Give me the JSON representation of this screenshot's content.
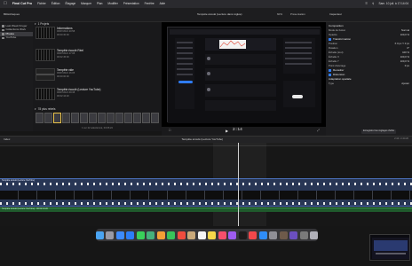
{
  "menubar": {
    "app_name": "Final Cut Pro",
    "items": [
      "Fichier",
      "Édition",
      "Élagage",
      "Marquer",
      "Plan",
      "Modifier",
      "Présentation",
      "Fenêtre",
      "Aide"
    ],
    "clock": "Sam. 10 juil. à 17:14:04"
  },
  "library_header": {
    "title": "Bibliothèques"
  },
  "viewer_header": {
    "title": "Tempête écoulé (Lecture dans réglée)",
    "zoom": "60%",
    "mode": "Présentation"
  },
  "inspector_header": {
    "title": "Inspecteur"
  },
  "sidebar": {
    "items": [
      {
        "label": "Last Week Kruger"
      },
      {
        "label": "Collections Work"
      },
      {
        "label": "Photos"
      },
      {
        "label": "YouTube"
      }
    ]
  },
  "browser": {
    "group_label": "1 Projets",
    "clips": [
      {
        "title": "Informations",
        "sub1": "06/07/2021 20:58",
        "sub2": "00:00:30:00"
      },
      {
        "title": "Tempête écoulé Réel",
        "sub1": "06/07/2021 17:08",
        "sub2": "00:02:45:00"
      },
      {
        "title": "Tempête vide",
        "sub1": "06/07/2021 16:05",
        "sub2": "00:00:00:00"
      },
      {
        "title": "Tempête écoulé (Lecture YouTube)",
        "sub1": "06/07/2021 09:38",
        "sub2": "00:02:44:20"
      }
    ],
    "filmstrip_group": "78 plus rebels",
    "footer": "1 sur 22 sélectionné, 03:06:24"
  },
  "viewer": {
    "timecode": "2:14"
  },
  "inspector": {
    "rows": [
      {
        "label": "Composition",
        "value": ""
      },
      {
        "label": "Mode de fusion",
        "value": "Normal"
      },
      {
        "label": "Opacité",
        "value": "100,0 %"
      },
      {
        "label": "Transformation",
        "value": ""
      },
      {
        "label": "Position",
        "value": "X 0 px  Y 0 px"
      },
      {
        "label": "Rotation",
        "value": "0°"
      },
      {
        "label": "Échelle (tout)",
        "value": "100 %"
      },
      {
        "label": "Échelle X",
        "value": "100,0 %"
      },
      {
        "label": "Échelle Y",
        "value": "100,0 %"
      },
      {
        "label": "Point d'ancrage",
        "value": "0 px"
      },
      {
        "label": "Recadrer",
        "value": ""
      },
      {
        "label": "Distorsion",
        "value": ""
      },
      {
        "label": "Adaptation spatiale",
        "value": ""
      },
      {
        "label": "Type",
        "value": "Ajuster"
      }
    ],
    "footer_button": "Enregistrer les réglages d'effet"
  },
  "timeline": {
    "index_label": "Index",
    "project": "Tempête écoulé (Lecture YouTube)",
    "duration": "2:44 / 2:44:20",
    "clip_label": "Tempête écoulé (Lecture YouTube)",
    "audio_label": "Tempête écoulé (Lecture YouTube) - 00:02:44:20"
  },
  "dock": {
    "icons": [
      "finder-icon",
      "launchpad-icon",
      "safari-icon",
      "mail-icon",
      "messages-icon",
      "maps-icon",
      "photos-icon",
      "facetime-icon",
      "calendar-icon",
      "contacts-icon",
      "reminders-icon",
      "notes-icon",
      "music-icon",
      "podcasts-icon",
      "tv-icon",
      "news-icon",
      "appstore-icon",
      "settings-icon",
      "finalcut-icon",
      "motion-icon",
      "compressor-icon",
      "trash-icon"
    ],
    "colors": [
      "#4aa4f2",
      "#9a9aa5",
      "#3d8bfd",
      "#2c7ef8",
      "#39d05a",
      "#46b07b",
      "#f4a035",
      "#37c35a",
      "#f04c3e",
      "#c9a97a",
      "#f4f4f4",
      "#f6d64a",
      "#f74f6b",
      "#9e5cf0",
      "#1c1c1c",
      "#f2484b",
      "#2f8df8",
      "#8f8f96",
      "#6e5a4a",
      "#6b4fbf",
      "#7a7a7a",
      "#b0b0b8"
    ]
  }
}
